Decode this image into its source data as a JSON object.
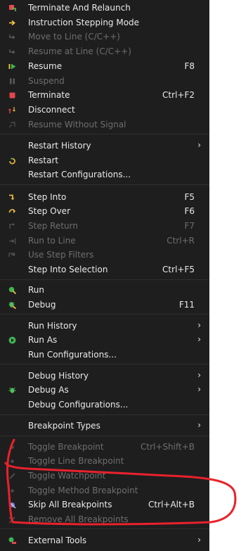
{
  "menu": {
    "items": [
      {
        "label": "Terminate And Relaunch",
        "shortcut": "",
        "enabled": true,
        "icon": "terminate-relaunch-icon"
      },
      {
        "label": "Instruction Stepping Mode",
        "shortcut": "",
        "enabled": true,
        "icon": "instruction-stepping-icon"
      },
      {
        "label": "Move to Line (C/C++)",
        "shortcut": "",
        "enabled": false,
        "icon": "move-to-line-icon"
      },
      {
        "label": "Resume at Line (C/C++)",
        "shortcut": "",
        "enabled": false,
        "icon": "resume-at-line-icon"
      },
      {
        "label": "Resume",
        "shortcut": "F8",
        "enabled": true,
        "icon": "resume-icon"
      },
      {
        "label": "Suspend",
        "shortcut": "",
        "enabled": false,
        "icon": "suspend-icon"
      },
      {
        "label": "Terminate",
        "shortcut": "Ctrl+F2",
        "enabled": true,
        "icon": "terminate-icon"
      },
      {
        "label": "Disconnect",
        "shortcut": "",
        "enabled": true,
        "icon": "disconnect-icon"
      },
      {
        "label": "Resume Without Signal",
        "shortcut": "",
        "enabled": false,
        "icon": "resume-without-signal-icon"
      },
      {
        "label": "Restart History",
        "shortcut": "",
        "enabled": true,
        "icon": "",
        "submenu": true
      },
      {
        "label": "Restart",
        "shortcut": "",
        "enabled": true,
        "icon": "restart-icon"
      },
      {
        "label": "Restart Configurations...",
        "shortcut": "",
        "enabled": true,
        "icon": ""
      },
      {
        "label": "Step Into",
        "shortcut": "F5",
        "enabled": true,
        "icon": "step-into-icon"
      },
      {
        "label": "Step Over",
        "shortcut": "F6",
        "enabled": true,
        "icon": "step-over-icon"
      },
      {
        "label": "Step Return",
        "shortcut": "F7",
        "enabled": false,
        "icon": "step-return-icon"
      },
      {
        "label": "Run to Line",
        "shortcut": "Ctrl+R",
        "enabled": false,
        "icon": "run-to-line-icon"
      },
      {
        "label": "Use Step Filters",
        "shortcut": "",
        "enabled": false,
        "icon": "step-filters-icon"
      },
      {
        "label": "Step Into Selection",
        "shortcut": "Ctrl+F5",
        "enabled": true,
        "icon": ""
      },
      {
        "label": "Run",
        "shortcut": "",
        "enabled": true,
        "icon": "run-icon"
      },
      {
        "label": "Debug",
        "shortcut": "F11",
        "enabled": true,
        "icon": "debug-icon"
      },
      {
        "label": "Run History",
        "shortcut": "",
        "enabled": true,
        "icon": "",
        "submenu": true
      },
      {
        "label": "Run As",
        "shortcut": "",
        "enabled": true,
        "icon": "run-as-icon",
        "submenu": true
      },
      {
        "label": "Run Configurations...",
        "shortcut": "",
        "enabled": true,
        "icon": ""
      },
      {
        "label": "Debug History",
        "shortcut": "",
        "enabled": true,
        "icon": "",
        "submenu": true
      },
      {
        "label": "Debug As",
        "shortcut": "",
        "enabled": true,
        "icon": "debug-as-icon",
        "submenu": true
      },
      {
        "label": "Debug Configurations...",
        "shortcut": "",
        "enabled": true,
        "icon": ""
      },
      {
        "label": "Breakpoint Types",
        "shortcut": "",
        "enabled": true,
        "icon": "",
        "submenu": true
      },
      {
        "label": "Toggle Breakpoint",
        "shortcut": "Ctrl+Shift+B",
        "enabled": false,
        "icon": "toggle-breakpoint-icon"
      },
      {
        "label": "Toggle Line Breakpoint",
        "shortcut": "",
        "enabled": false,
        "icon": "toggle-line-breakpoint-icon"
      },
      {
        "label": "Toggle Watchpoint",
        "shortcut": "",
        "enabled": false,
        "icon": "toggle-watchpoint-icon"
      },
      {
        "label": "Toggle Method Breakpoint",
        "shortcut": "",
        "enabled": false,
        "icon": "toggle-method-breakpoint-icon"
      },
      {
        "label": "Skip All Breakpoints",
        "shortcut": "Ctrl+Alt+B",
        "enabled": true,
        "icon": "skip-breakpoints-icon"
      },
      {
        "label": "Remove All Breakpoints",
        "shortcut": "",
        "enabled": false,
        "icon": "remove-breakpoints-icon"
      },
      {
        "label": "External Tools",
        "shortcut": "",
        "enabled": true,
        "icon": "external-tools-icon",
        "submenu": true
      }
    ],
    "submenu_glyph": "›"
  },
  "colors": {
    "menu_bg": "#1e1e1f",
    "text": "#eaeaea",
    "disabled_text": "#6e6e6e",
    "annotation": "#e8222b"
  }
}
